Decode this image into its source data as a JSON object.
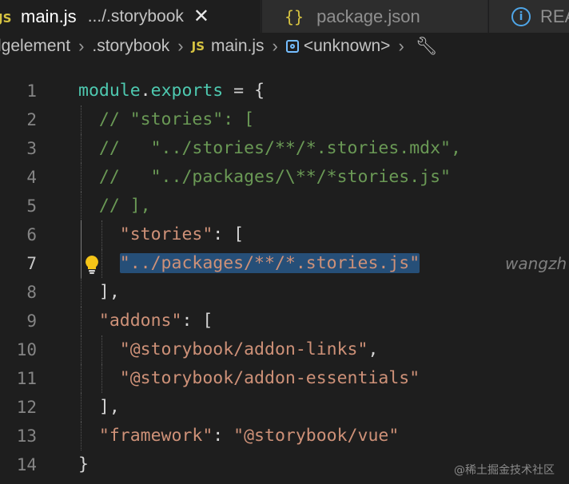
{
  "tabs": [
    {
      "icon": "JS",
      "name": "main.js",
      "dir": ".../.storybook",
      "close": "✕"
    },
    {
      "icon": "{}",
      "name": "package.json"
    },
    {
      "icon": "ⓘ",
      "name": "READ"
    }
  ],
  "breadcrumb": {
    "items": [
      "lgelement",
      ".storybook",
      "main.js",
      "<unknown>"
    ],
    "file_icon": "JS"
  },
  "editor": {
    "lines": [
      {
        "n": "1",
        "tokens": [
          {
            "t": "module",
            "c": "prop"
          },
          {
            "t": ".",
            "c": "punc"
          },
          {
            "t": "exports",
            "c": "prop"
          },
          {
            "t": " = {",
            "c": "punc"
          }
        ]
      },
      {
        "n": "2",
        "tokens": [
          {
            "t": "  // \"stories\": [",
            "c": "cmt"
          }
        ]
      },
      {
        "n": "3",
        "tokens": [
          {
            "t": "  //   \"../stories/**/*.stories.mdx\",",
            "c": "cmt"
          }
        ]
      },
      {
        "n": "4",
        "tokens": [
          {
            "t": "  //   \"../packages/\\**/*stories.js\"",
            "c": "cmt"
          }
        ]
      },
      {
        "n": "5",
        "tokens": [
          {
            "t": "  // ],",
            "c": "cmt"
          }
        ]
      },
      {
        "n": "6",
        "tokens": [
          {
            "t": "    ",
            "c": "punc"
          },
          {
            "t": "\"stories\"",
            "c": "str"
          },
          {
            "t": ": [",
            "c": "punc"
          }
        ]
      },
      {
        "n": "7",
        "tokens": [
          {
            "t": "    ",
            "c": "punc"
          },
          {
            "t": "\"../packages/**/*.stories.js\"",
            "c": "str",
            "sel": true
          }
        ],
        "current": true,
        "bulb": true,
        "blame": "wangzh"
      },
      {
        "n": "8",
        "tokens": [
          {
            "t": "  ],",
            "c": "punc"
          }
        ]
      },
      {
        "n": "9",
        "tokens": [
          {
            "t": "  ",
            "c": "punc"
          },
          {
            "t": "\"addons\"",
            "c": "str"
          },
          {
            "t": ": [",
            "c": "punc"
          }
        ]
      },
      {
        "n": "10",
        "tokens": [
          {
            "t": "    ",
            "c": "punc"
          },
          {
            "t": "\"@storybook/addon-links\"",
            "c": "str"
          },
          {
            "t": ",",
            "c": "punc"
          }
        ]
      },
      {
        "n": "11",
        "tokens": [
          {
            "t": "    ",
            "c": "punc"
          },
          {
            "t": "\"@storybook/addon-essentials\"",
            "c": "str"
          }
        ]
      },
      {
        "n": "12",
        "tokens": [
          {
            "t": "  ],",
            "c": "punc"
          }
        ]
      },
      {
        "n": "13",
        "tokens": [
          {
            "t": "  ",
            "c": "punc"
          },
          {
            "t": "\"framework\"",
            "c": "str"
          },
          {
            "t": ": ",
            "c": "punc"
          },
          {
            "t": "\"@storybook/vue\"",
            "c": "str"
          }
        ]
      },
      {
        "n": "14",
        "tokens": [
          {
            "t": "}",
            "c": "punc"
          }
        ]
      }
    ]
  },
  "watermark": "@稀土掘金技术社区",
  "colors": {
    "background": "#1e1e1e",
    "selection": "#264f78",
    "string": "#ce9178",
    "comment": "#6a9955",
    "property": "#4ec9b0"
  }
}
